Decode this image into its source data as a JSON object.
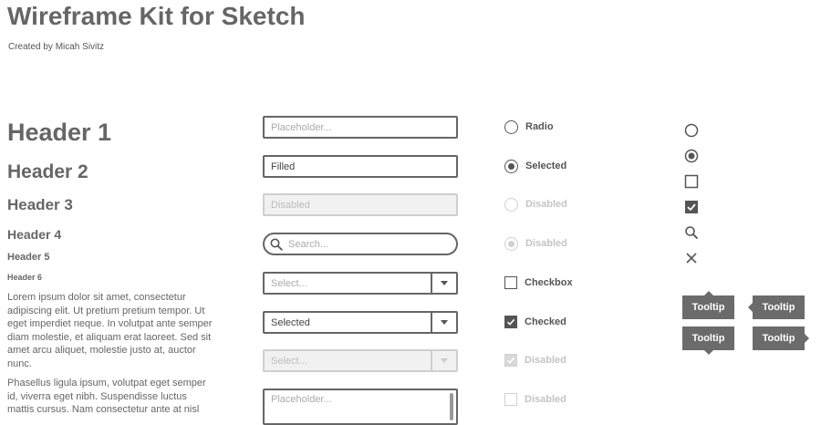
{
  "page": {
    "title": "Wireframe Kit for Sketch",
    "subtitle": "Created by Micah Sivitz"
  },
  "typography": {
    "headers": [
      "Header 1",
      "Header 2",
      "Header 3",
      "Header 4",
      "Header 5",
      "Header 6"
    ],
    "paragraph1": "Lorem ipsum dolor sit amet, consectetur adipiscing elit. Ut pretium pretium tempor. Ut eget imperdiet neque. In volutpat ante semper diam molestie, et aliquam erat laoreet. Sed sit amet arcu aliquet, molestie justo at, auctor nunc.",
    "paragraph2": "Phasellus ligula ipsum, volutpat eget semper id, viverra eget nibh. Suspendisse luctus mattis cursus. Nam consectetur ante at nisl"
  },
  "inputs": {
    "placeholder_text": "Placeholder...",
    "filled_value": "Filled",
    "disabled_text": "Disabled",
    "search_placeholder": "Search...",
    "select_placeholder": "Select...",
    "selected_value": "Selected",
    "select_disabled_placeholder": "Select...",
    "textarea_placeholder": "Placeholder..."
  },
  "controls": {
    "radio": "Radio",
    "radio_selected": "Selected",
    "radio_disabled": "Disabled",
    "radio_selected_disabled": "Disabled",
    "checkbox": "Checkbox",
    "checkbox_checked": "Checked",
    "checkbox_checked_disabled": "Disabled",
    "checkbox_disabled": "Disabled"
  },
  "icons": [
    "radio-empty-icon",
    "radio-filled-icon",
    "checkbox-empty-icon",
    "checkbox-checked-icon",
    "search-icon",
    "close-icon"
  ],
  "tooltips": {
    "top_arrow": "Tooltip",
    "left_arrow": "Tooltip",
    "bottom_arrow": "Tooltip",
    "right_arrow": "Tooltip"
  },
  "colors": {
    "ink": "#666666",
    "tooltip_bg": "#6b6b6b",
    "disabled": "#cfcfcf"
  }
}
